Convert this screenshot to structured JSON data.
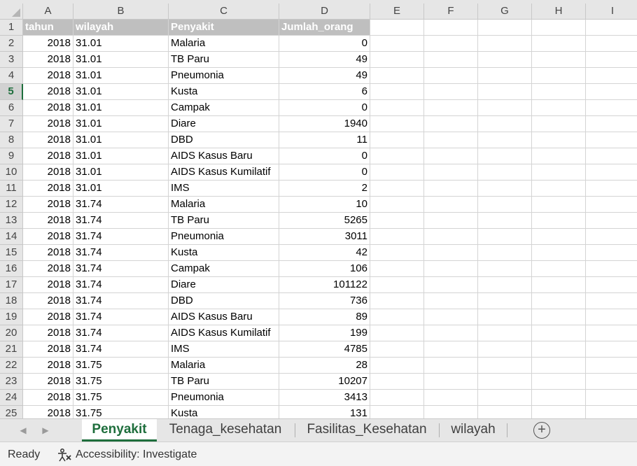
{
  "columns": [
    "A",
    "B",
    "C",
    "D",
    "E",
    "F",
    "G",
    "H",
    "I"
  ],
  "header": {
    "tahun": "tahun",
    "wilayah": "wilayah",
    "penyakit": "Penyakit",
    "jumlah": "Jumlah_orang"
  },
  "rows": [
    {
      "n": "2",
      "tahun": "2018",
      "wilayah": "31.01",
      "penyakit": "Malaria",
      "jumlah": "0"
    },
    {
      "n": "3",
      "tahun": "2018",
      "wilayah": "31.01",
      "penyakit": "TB Paru",
      "jumlah": "49"
    },
    {
      "n": "4",
      "tahun": "2018",
      "wilayah": "31.01",
      "penyakit": "Pneumonia",
      "jumlah": "49"
    },
    {
      "n": "5",
      "tahun": "2018",
      "wilayah": "31.01",
      "penyakit": "Kusta",
      "jumlah": "6"
    },
    {
      "n": "6",
      "tahun": "2018",
      "wilayah": "31.01",
      "penyakit": "Campak",
      "jumlah": "0"
    },
    {
      "n": "7",
      "tahun": "2018",
      "wilayah": "31.01",
      "penyakit": "Diare",
      "jumlah": "1940"
    },
    {
      "n": "8",
      "tahun": "2018",
      "wilayah": "31.01",
      "penyakit": "DBD",
      "jumlah": "11"
    },
    {
      "n": "9",
      "tahun": "2018",
      "wilayah": "31.01",
      "penyakit": "AIDS Kasus Baru",
      "jumlah": "0"
    },
    {
      "n": "10",
      "tahun": "2018",
      "wilayah": "31.01",
      "penyakit": "AIDS Kasus Kumilatif",
      "jumlah": "0"
    },
    {
      "n": "11",
      "tahun": "2018",
      "wilayah": "31.01",
      "penyakit": "IMS",
      "jumlah": "2"
    },
    {
      "n": "12",
      "tahun": "2018",
      "wilayah": "31.74",
      "penyakit": "Malaria",
      "jumlah": "10"
    },
    {
      "n": "13",
      "tahun": "2018",
      "wilayah": "31.74",
      "penyakit": "TB Paru",
      "jumlah": "5265"
    },
    {
      "n": "14",
      "tahun": "2018",
      "wilayah": "31.74",
      "penyakit": "Pneumonia",
      "jumlah": "3011"
    },
    {
      "n": "15",
      "tahun": "2018",
      "wilayah": "31.74",
      "penyakit": "Kusta",
      "jumlah": "42"
    },
    {
      "n": "16",
      "tahun": "2018",
      "wilayah": "31.74",
      "penyakit": "Campak",
      "jumlah": "106"
    },
    {
      "n": "17",
      "tahun": "2018",
      "wilayah": "31.74",
      "penyakit": "Diare",
      "jumlah": "101122"
    },
    {
      "n": "18",
      "tahun": "2018",
      "wilayah": "31.74",
      "penyakit": "DBD",
      "jumlah": "736"
    },
    {
      "n": "19",
      "tahun": "2018",
      "wilayah": "31.74",
      "penyakit": "AIDS Kasus Baru",
      "jumlah": "89"
    },
    {
      "n": "20",
      "tahun": "2018",
      "wilayah": "31.74",
      "penyakit": "AIDS Kasus Kumilatif",
      "jumlah": "199"
    },
    {
      "n": "21",
      "tahun": "2018",
      "wilayah": "31.74",
      "penyakit": "IMS",
      "jumlah": "4785"
    },
    {
      "n": "22",
      "tahun": "2018",
      "wilayah": "31.75",
      "penyakit": "Malaria",
      "jumlah": "28"
    },
    {
      "n": "23",
      "tahun": "2018",
      "wilayah": "31.75",
      "penyakit": "TB Paru",
      "jumlah": "10207"
    },
    {
      "n": "24",
      "tahun": "2018",
      "wilayah": "31.75",
      "penyakit": "Pneumonia",
      "jumlah": "3413"
    },
    {
      "n": "25",
      "tahun": "2018",
      "wilayah": "31.75",
      "penyakit": "Kusta",
      "jumlah": "131"
    }
  ],
  "sheets": [
    "Penyakit",
    "Tenaga_kesehatan",
    "Fasilitas_Kesehatan",
    "wilayah"
  ],
  "active_sheet": "Penyakit",
  "status": {
    "ready": "Ready",
    "accessibility": "Accessibility: Investigate"
  },
  "colors": {
    "accent": "#1e6e3c",
    "header_fill": "#bfbfbf"
  }
}
